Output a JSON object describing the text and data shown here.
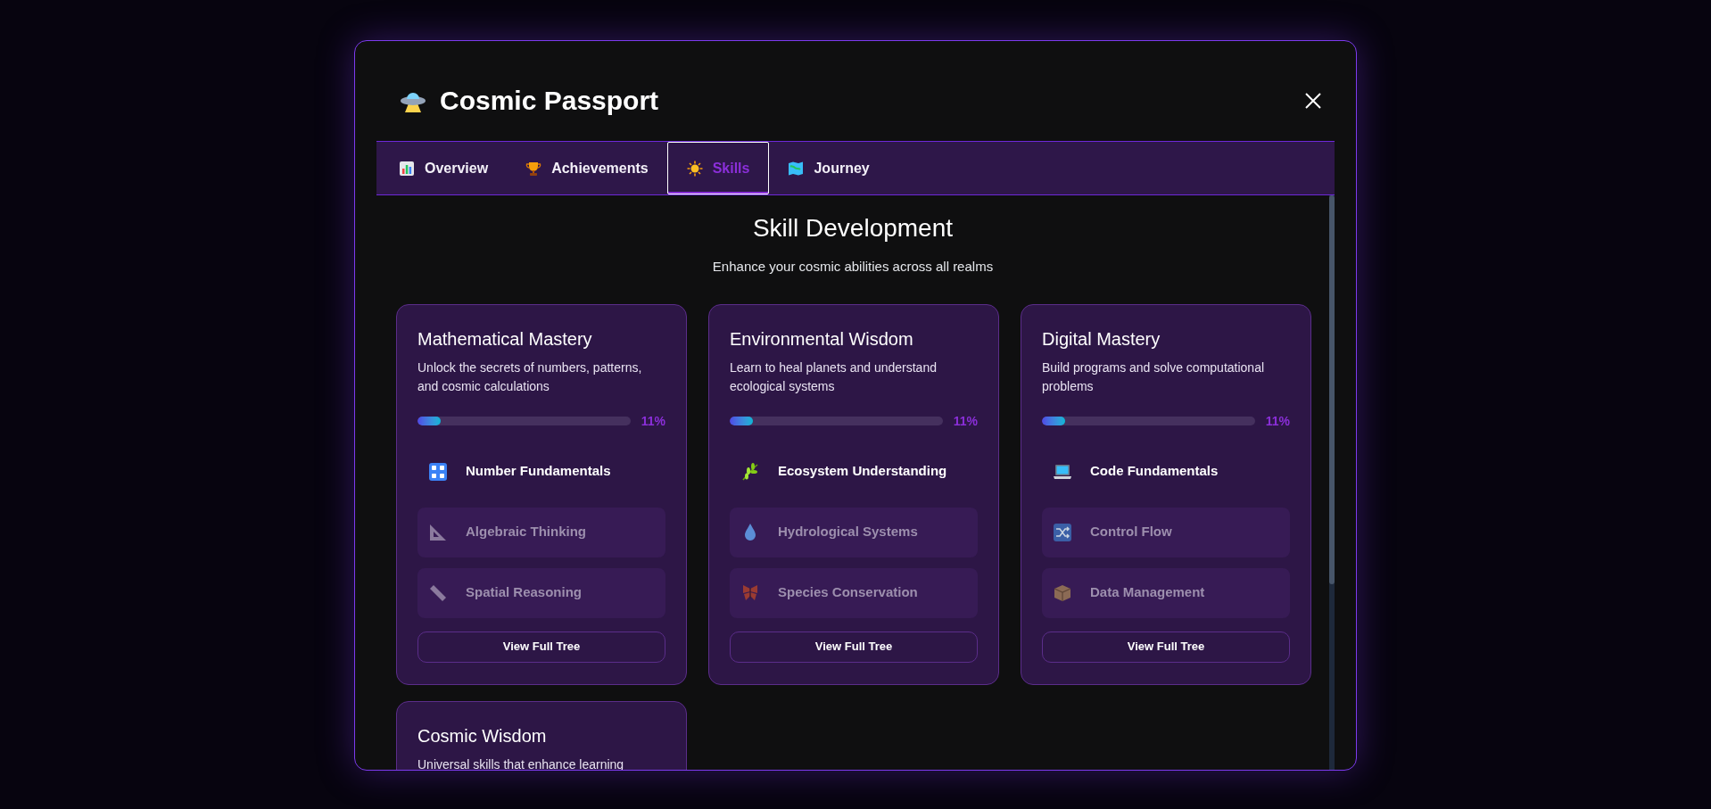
{
  "modal": {
    "title": "Cosmic Passport"
  },
  "tabs": [
    {
      "label": "Overview",
      "selected": false
    },
    {
      "label": "Achievements",
      "selected": false
    },
    {
      "label": "Skills",
      "selected": true
    },
    {
      "label": "Journey",
      "selected": false
    }
  ],
  "section": {
    "title": "Skill Development",
    "subtitle": "Enhance your cosmic abilities across all realms"
  },
  "skill_trees": [
    {
      "title": "Mathematical Mastery",
      "description": "Unlock the secrets of numbers, patterns, and cosmic calculations",
      "level": 0.11,
      "percent": "11%",
      "skills": [
        {
          "name": "Number Fundamentals",
          "locked": false
        },
        {
          "name": "Algebraic Thinking",
          "locked": true
        },
        {
          "name": "Spatial Reasoning",
          "locked": true
        }
      ],
      "button": "View Full Tree"
    },
    {
      "title": "Environmental Wisdom",
      "description": "Learn to heal planets and understand ecological systems",
      "level": 0.11,
      "percent": "11%",
      "skills": [
        {
          "name": "Ecosystem Understanding",
          "locked": false
        },
        {
          "name": "Hydrological Systems",
          "locked": true
        },
        {
          "name": "Species Conservation",
          "locked": true
        }
      ],
      "button": "View Full Tree"
    },
    {
      "title": "Digital Mastery",
      "description": "Build programs and solve computational problems",
      "level": 0.11,
      "percent": "11%",
      "skills": [
        {
          "name": "Code Fundamentals",
          "locked": false
        },
        {
          "name": "Control Flow",
          "locked": true
        },
        {
          "name": "Data Management",
          "locked": true
        }
      ],
      "button": "View Full Tree"
    },
    {
      "title": "Cosmic Wisdom",
      "description": "Universal skills that enhance learning"
    }
  ]
}
